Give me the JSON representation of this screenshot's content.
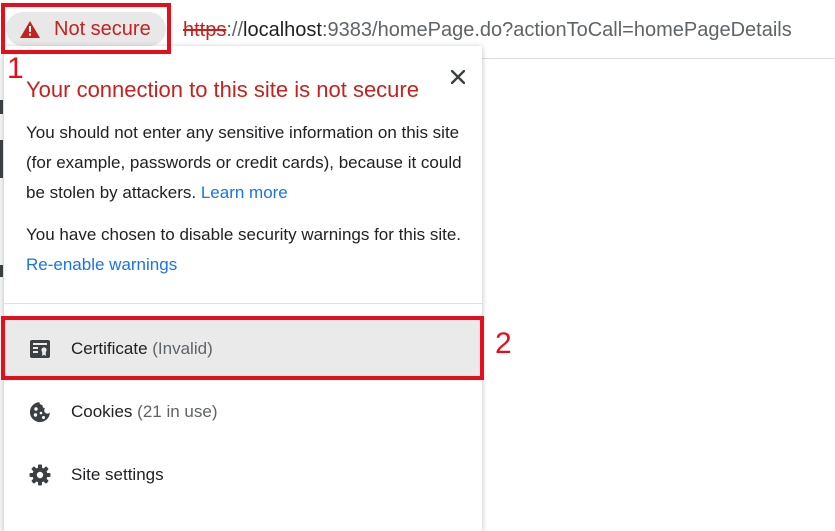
{
  "omnibox": {
    "security_chip_label": "Not secure",
    "url_scheme": "https",
    "url_separator": "://",
    "url_host": "localhost",
    "url_rest": ":9383/homePage.do?actionToCall=homePageDetails"
  },
  "popup": {
    "title": "Your connection to this site is not secure",
    "paragraph1": "You should not enter any sensitive information on this site (for example, passwords or credit cards), because it could be stolen by attackers.",
    "learn_more": "Learn more",
    "paragraph2": "You have chosen to disable security warnings for this site.",
    "reenable_link": "Re-enable warnings",
    "rows": [
      {
        "label": "Certificate",
        "sub": "(Invalid)",
        "icon": "certificate-icon"
      },
      {
        "label": "Cookies",
        "sub": "(21 in use)",
        "icon": "cookie-icon"
      },
      {
        "label": "Site settings",
        "sub": "",
        "icon": "gear-icon"
      }
    ]
  },
  "annotations": {
    "label1": "1",
    "label2": "2"
  },
  "colors": {
    "warning_red": "#c5221f",
    "link_blue": "#1a73e8",
    "annotation_red": "#e3101c",
    "highlight_row": "#eaeaea"
  }
}
